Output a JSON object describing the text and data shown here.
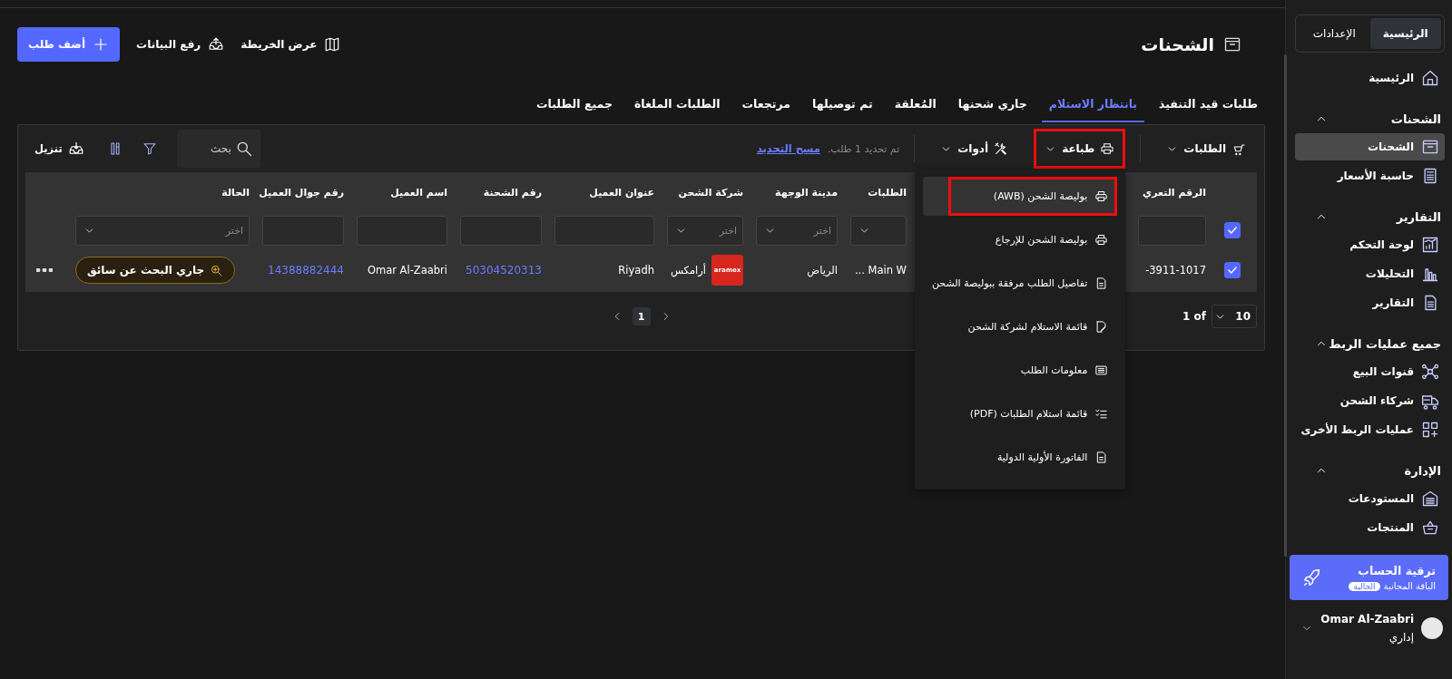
{
  "header": {
    "title": "الشحنات",
    "actions": [
      {
        "kind": "plain",
        "label": "عرض الخريطة"
      },
      {
        "kind": "plain",
        "label": "رفع البيانات"
      },
      {
        "kind": "primary",
        "label": "أضف طلب"
      }
    ]
  },
  "tabs": [
    {
      "label": "طلبات قيد التنفيذ",
      "selected": false
    },
    {
      "label": "بانتظار الاستلام",
      "selected": true
    },
    {
      "label": "جاري شحنها",
      "selected": false
    },
    {
      "label": "المُعلقة",
      "selected": false
    },
    {
      "label": "تم توصيلها",
      "selected": false
    },
    {
      "label": "مرتجعات",
      "selected": false
    },
    {
      "label": "الطلبات الملغاة",
      "selected": false
    },
    {
      "label": "جميع الطلبات",
      "selected": false
    }
  ],
  "toolbar": {
    "menus": [
      {
        "label": "الطلبات",
        "expanded": false,
        "highlighted": false
      },
      {
        "label": "طباعة",
        "expanded": true,
        "highlighted": true
      },
      {
        "label": "أدوات",
        "expanded": false,
        "highlighted": false
      }
    ],
    "selection_note": "تم تحديد 1 طلب.",
    "clear_link": "مسح التحديد",
    "search": {
      "placeholder": "بحث"
    },
    "download": "تنزيل"
  },
  "table": {
    "all_selected": true,
    "columns": [
      {
        "label": "الرقم التعري",
        "kind": "input"
      },
      {
        "label": "الطلبات",
        "kind": "select"
      },
      {
        "label": "مدينة الوجهة",
        "kind": "select",
        "placeholder": "اختر"
      },
      {
        "label": "شركة الشحن",
        "kind": "select",
        "placeholder": "اختر"
      },
      {
        "label": "عنوان العميل",
        "kind": "input"
      },
      {
        "label": "رقم الشحنة",
        "kind": "input"
      },
      {
        "label": "اسم العميل",
        "kind": "input"
      },
      {
        "label": "رقم جوال العميل",
        "kind": "input"
      },
      {
        "label": "الحالة",
        "kind": "select",
        "placeholder": "اختر"
      }
    ],
    "rows": [
      {
        "selected": true,
        "cells": [
          {
            "kind": "text",
            "text": "-3911-1017"
          },
          {
            "kind": "text",
            "text": "Main W ..."
          },
          {
            "kind": "text",
            "text": "الرياض"
          },
          {
            "kind": "carrier",
            "logo": "aramex",
            "text": "أرامكس"
          },
          {
            "kind": "text",
            "text": "Riyadh"
          },
          {
            "kind": "link",
            "text": "50304520313"
          },
          {
            "kind": "text",
            "text": "Omar Al-Zaabri"
          },
          {
            "kind": "link",
            "text": "14388882444"
          },
          {
            "kind": "status",
            "text": "جاري البحث عن سائق"
          }
        ]
      }
    ]
  },
  "pagination": {
    "page_size": "10",
    "of_label": "1 of",
    "pages": [
      {
        "label": "1",
        "selected": true
      }
    ]
  },
  "print_menu": [
    {
      "label": "بوليصة الشحن (AWB)",
      "selected": true,
      "highlighted": true
    },
    {
      "label": "بوليصة الشحن للإرجاع",
      "selected": false,
      "highlighted": false
    },
    {
      "label": "تفاصيل الطلب مرفقة ببوليصة الشحن",
      "selected": false,
      "highlighted": false
    },
    {
      "label": "قائمة الاستلام لشركة الشحن",
      "selected": false,
      "highlighted": false
    },
    {
      "label": "معلومات الطلب",
      "selected": false,
      "highlighted": false
    },
    {
      "label": "قائمة استلام الطلبات (PDF)",
      "selected": false,
      "highlighted": false
    },
    {
      "label": "الفاتورة الأولية الدولية",
      "selected": false,
      "highlighted": false
    }
  ],
  "sidebar": {
    "switch": [
      {
        "label": "الرئيسية",
        "selected": true
      },
      {
        "label": "الإعدادات",
        "selected": false
      }
    ],
    "items": [
      {
        "kind": "item",
        "label": "الرئيسية",
        "selected": false
      },
      {
        "kind": "section",
        "label": "الشحنات",
        "expanded": true,
        "children": [
          {
            "kind": "item",
            "label": "الشحنات",
            "selected": true
          },
          {
            "kind": "item",
            "label": "حاسبة الأسعار",
            "selected": false
          }
        ]
      },
      {
        "kind": "section",
        "label": "التقارير",
        "expanded": true,
        "children": [
          {
            "kind": "item",
            "label": "لوحة التحكم",
            "selected": false
          },
          {
            "kind": "item",
            "label": "التحليلات",
            "selected": false
          },
          {
            "kind": "item",
            "label": "التقارير",
            "selected": false
          }
        ]
      },
      {
        "kind": "section",
        "label": "جميع عمليات الربط",
        "expanded": true,
        "children": [
          {
            "kind": "item",
            "label": "قنوات البيع",
            "selected": false
          },
          {
            "kind": "item",
            "label": "شركاء الشحن",
            "selected": false
          },
          {
            "kind": "item",
            "label": "عمليات الربط الأخرى",
            "selected": false
          }
        ]
      },
      {
        "kind": "section",
        "label": "الإدارة",
        "expanded": true,
        "children": [
          {
            "kind": "item",
            "label": "المستودعات",
            "selected": false
          },
          {
            "kind": "item",
            "label": "المنتجات",
            "selected": false
          }
        ]
      }
    ],
    "upgrade": {
      "title": "ترقية الحساب",
      "plan": "الباقة المجانية",
      "badge": "الحالية"
    },
    "user": {
      "name": "Omar Al-Zaabri",
      "role": "إداري"
    }
  }
}
